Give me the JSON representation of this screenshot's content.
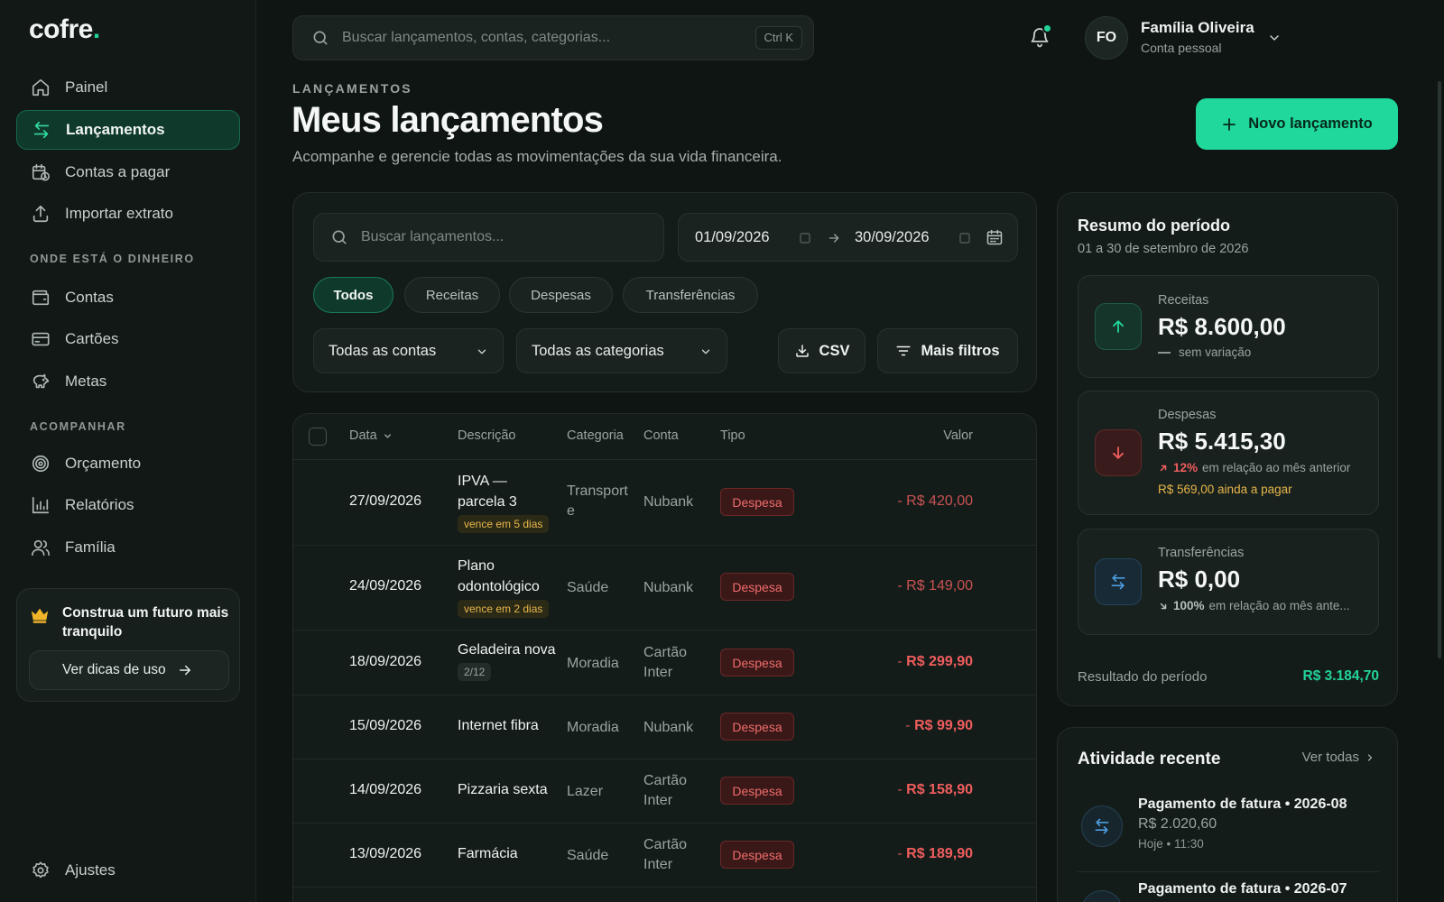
{
  "brand": {
    "name": "cofre",
    "dot": "."
  },
  "sidebar": {
    "main_items": [
      {
        "label": "Painel",
        "icon": "home-icon"
      },
      {
        "label": "Lançamentos",
        "icon": "transfer-arrows-icon",
        "active": true
      },
      {
        "label": "Contas a pagar",
        "icon": "calendar-clock-icon"
      },
      {
        "label": "Importar extrato",
        "icon": "upload-icon"
      }
    ],
    "section_money": "ONDE ESTÁ O DINHEIRO",
    "money_items": [
      {
        "label": "Contas",
        "icon": "wallet-icon"
      },
      {
        "label": "Cartões",
        "icon": "credit-card-icon"
      },
      {
        "label": "Metas",
        "icon": "piggy-bank-icon"
      }
    ],
    "section_track": "ACOMPANHAR",
    "track_items": [
      {
        "label": "Orçamento",
        "icon": "target-icon"
      },
      {
        "label": "Relatórios",
        "icon": "bar-chart-icon"
      },
      {
        "label": "Família",
        "icon": "users-icon"
      }
    ],
    "promo": {
      "title": "Construa um futuro mais tranquilo",
      "button": "Ver dicas de uso"
    },
    "settings": {
      "label": "Ajustes",
      "icon": "gear-icon"
    }
  },
  "topbar": {
    "search_placeholder": "Buscar lançamentos, contas, categorias...",
    "shortcut": "Ctrl K",
    "user": {
      "initials": "FO",
      "name": "Família Oliveira",
      "subtitle": "Conta pessoal"
    }
  },
  "header": {
    "eyebrow": "LANÇAMENTOS",
    "title": "Meus lançamentos",
    "subtitle": "Acompanhe e gerencie todas as movimentações da sua vida financeira.",
    "new_button": "Novo lançamento"
  },
  "filters": {
    "search_placeholder": "Buscar lançamentos...",
    "date_from": "01/09/2026",
    "date_to": "30/09/2026",
    "chips": [
      "Todos",
      "Receitas",
      "Despesas",
      "Transferências"
    ],
    "active_chip": "Todos",
    "account_select": "Todas as contas",
    "category_select": "Todas as categorias",
    "csv_button": "CSV",
    "more_button": "Mais filtros"
  },
  "table": {
    "headers": {
      "date": "Data",
      "description": "Descrição",
      "category": "Categoria",
      "account": "Conta",
      "type": "Tipo",
      "amount": "Valor"
    },
    "rows": [
      {
        "date": "27/09/2026",
        "desc1": "IPVA —",
        "desc2": "parcela 3",
        "tag": "vence em 5 dias",
        "category1": "Transport",
        "category2": "e",
        "account1": "Nubank",
        "account2": "",
        "type": "Despesa",
        "amount": "R$ 420,00",
        "amount_style": "pending"
      },
      {
        "date": "24/09/2026",
        "desc1": "Plano",
        "desc2": "odontológico",
        "tag": "vence em 2 dias",
        "category1": "Saúde",
        "category2": "",
        "account1": "Nubank",
        "account2": "",
        "type": "Despesa",
        "amount": "R$ 149,00",
        "amount_style": "pending"
      },
      {
        "date": "18/09/2026",
        "desc1": "Geladeira nova",
        "desc2": "",
        "installment": "2/12",
        "category1": "Moradia",
        "category2": "",
        "account1": "Cartão",
        "account2": "Inter",
        "type": "Despesa",
        "amount": "R$ 299,90",
        "amount_style": "paid"
      },
      {
        "date": "15/09/2026",
        "desc1": "Internet fibra",
        "desc2": "",
        "category1": "Moradia",
        "category2": "",
        "account1": "Nubank",
        "account2": "",
        "type": "Despesa",
        "amount": "R$ 99,90",
        "amount_style": "paid"
      },
      {
        "date": "14/09/2026",
        "desc1": "Pizzaria sexta",
        "desc2": "",
        "category1": "Lazer",
        "category2": "",
        "account1": "Cartão",
        "account2": "Inter",
        "type": "Despesa",
        "amount": "R$ 158,90",
        "amount_style": "paid"
      },
      {
        "date": "13/09/2026",
        "desc1": "Farmácia",
        "desc2": "",
        "category1": "Saúde",
        "category2": "",
        "account1": "Cartão",
        "account2": "Inter",
        "type": "Despesa",
        "amount": "R$ 189,90",
        "amount_style": "paid"
      }
    ],
    "minus_sign": "-"
  },
  "summary": {
    "title": "Resumo do período",
    "period": "01 a 30 de setembro de 2026",
    "income": {
      "label": "Receitas",
      "value": "R$ 8.600,00",
      "note": "sem variação",
      "color": "#22d39a"
    },
    "expenses": {
      "label": "Despesas",
      "value": "R$ 5.415,30",
      "pct": "12%",
      "note": "em relação ao mês anterior",
      "pending": "R$ 569,00 ainda a pagar",
      "color": "#ef5d5d"
    },
    "transfers": {
      "label": "Transferências",
      "value": "R$ 0,00",
      "pct": "100%",
      "note": "em relação ao mês ante...",
      "color": "#4d9de0"
    },
    "result_label": "Resultado do período",
    "result_value": "R$ 3.184,70"
  },
  "activity": {
    "title": "Atividade recente",
    "see_all": "Ver todas",
    "items": [
      {
        "title": "Pagamento de fatura • 2026-08",
        "value": "R$ 2.020,60",
        "meta": "Hoje • 11:30"
      },
      {
        "title": "Pagamento de fatura • 2026-07",
        "value": "",
        "meta": ""
      }
    ]
  }
}
